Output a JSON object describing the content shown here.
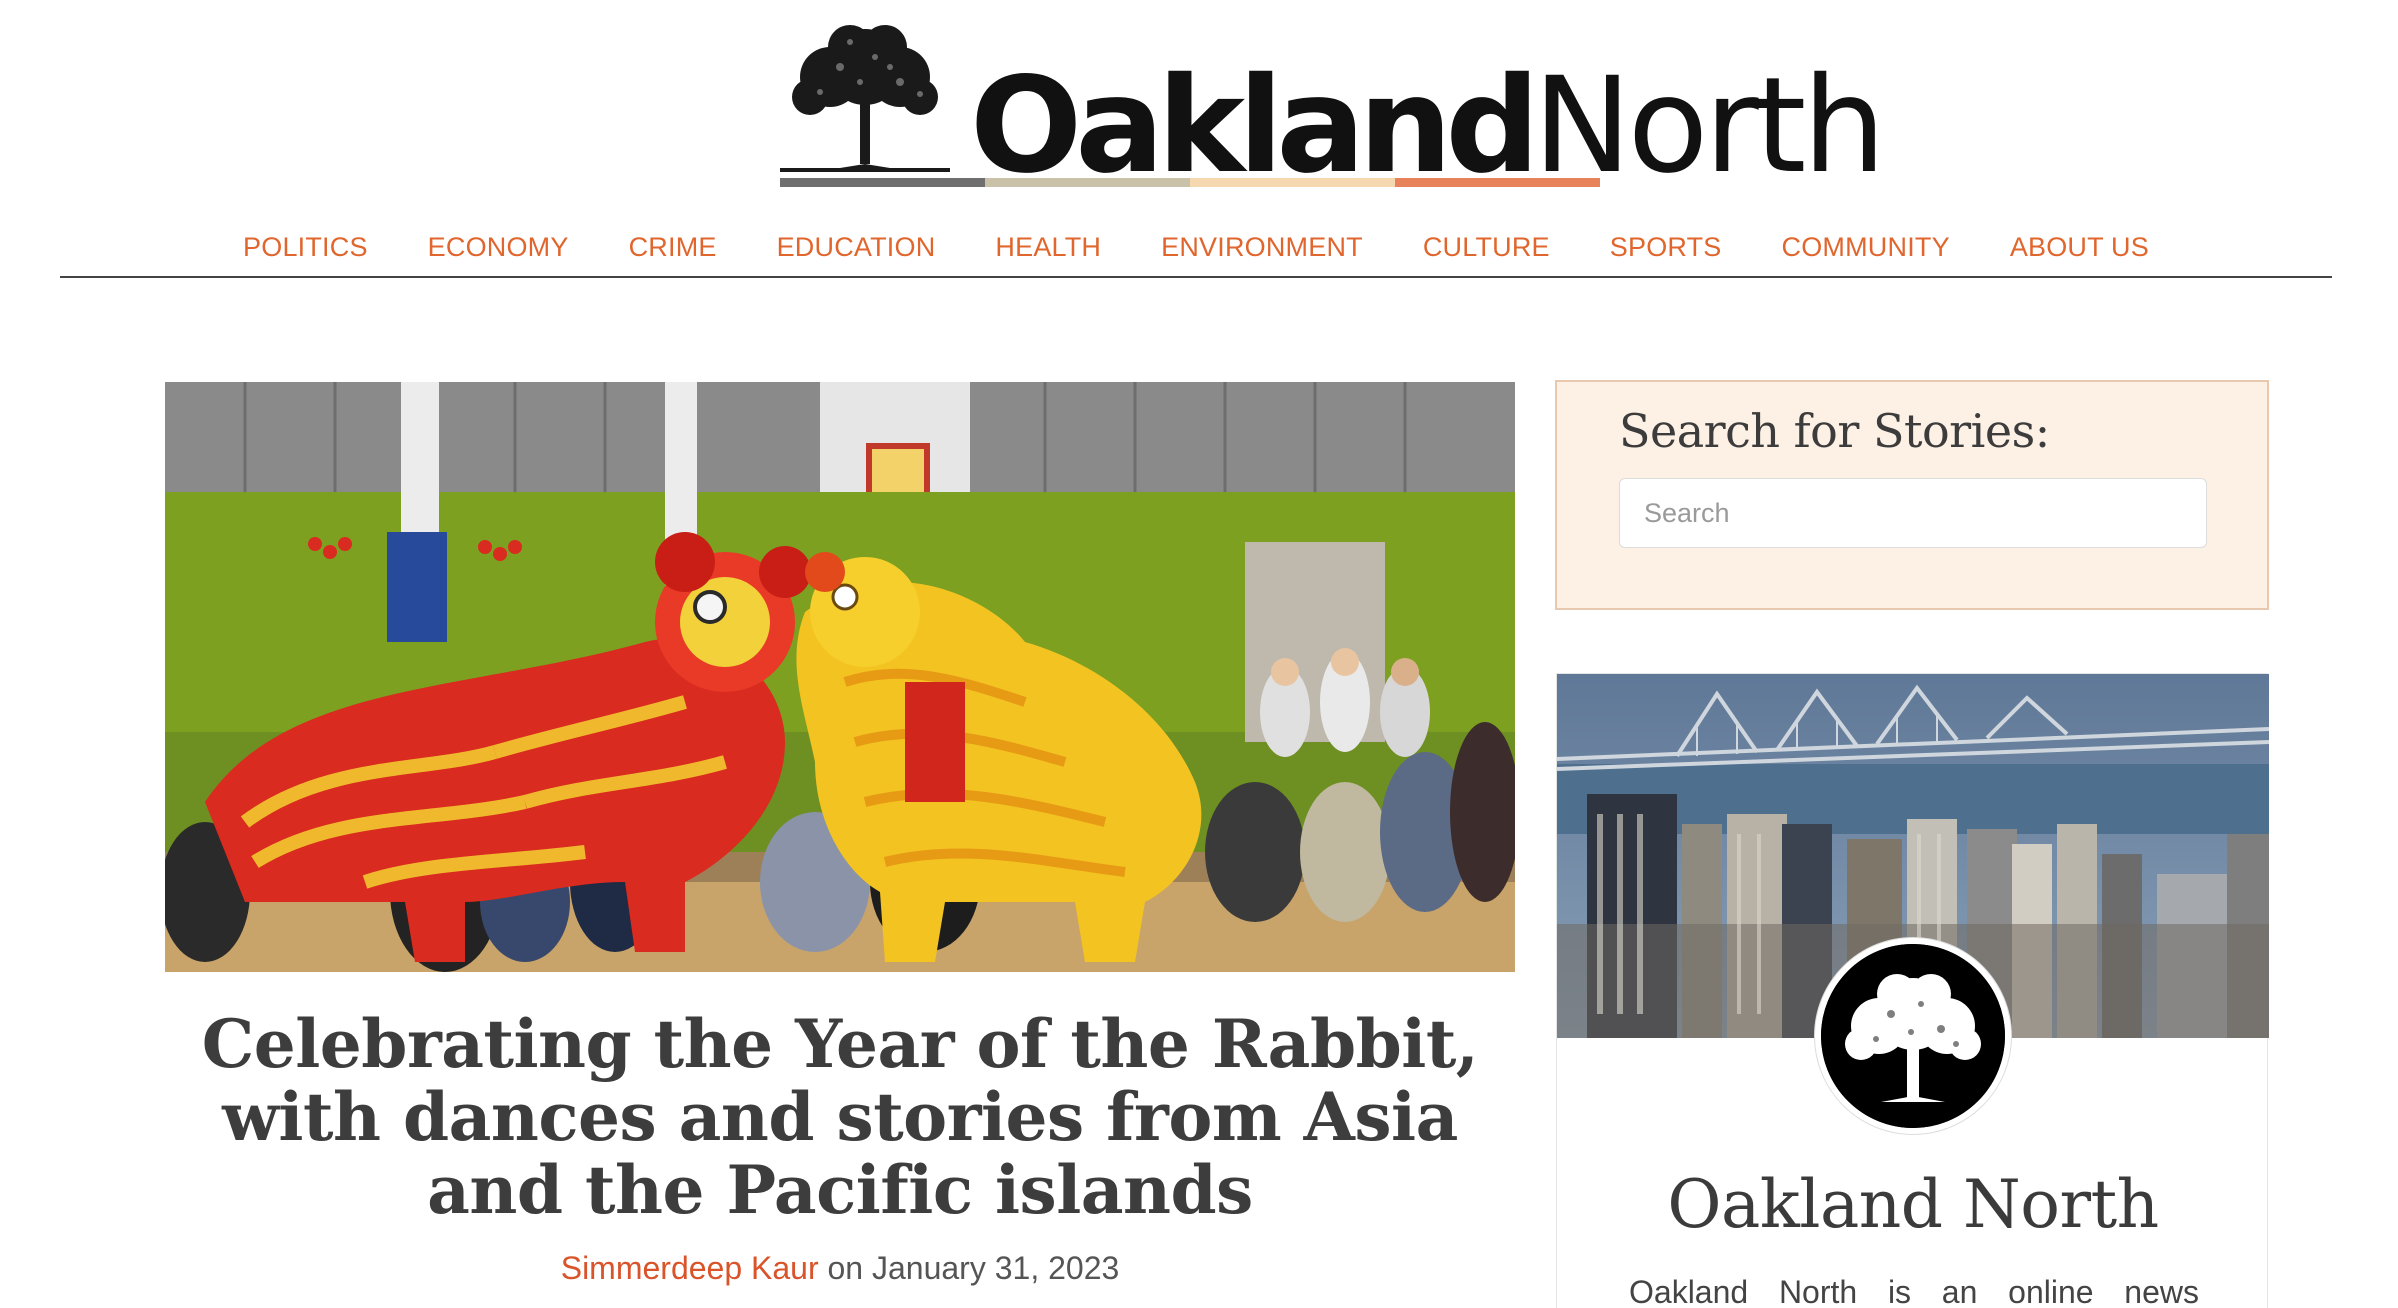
{
  "site": {
    "logo_part1": "Oakland",
    "logo_part2": "North",
    "stripe_colors": [
      "#6f6f6f",
      "#c9c2a8",
      "#f5d7b0",
      "#e8825a"
    ]
  },
  "nav": {
    "items": [
      "POLITICS",
      "ECONOMY",
      "CRIME",
      "EDUCATION",
      "HEALTH",
      "ENVIRONMENT",
      "CULTURE",
      "SPORTS",
      "COMMUNITY",
      "ABOUT US"
    ]
  },
  "featured": {
    "title": "Celebrating the Year of the Rabbit, with dances and stories from Asia and the Pacific islands",
    "author": "Simmerdeep Kaur",
    "date_prefix": "on",
    "date": "January 31, 2023"
  },
  "sidebar": {
    "search_title": "Search for Stories:",
    "search_placeholder": "Search",
    "about_title": "Oakland North",
    "about_text": "Oakland North is an online news"
  },
  "colors": {
    "accent": "#e0662e",
    "author_link": "#d9542b",
    "search_bg": "#fdf0e5"
  }
}
